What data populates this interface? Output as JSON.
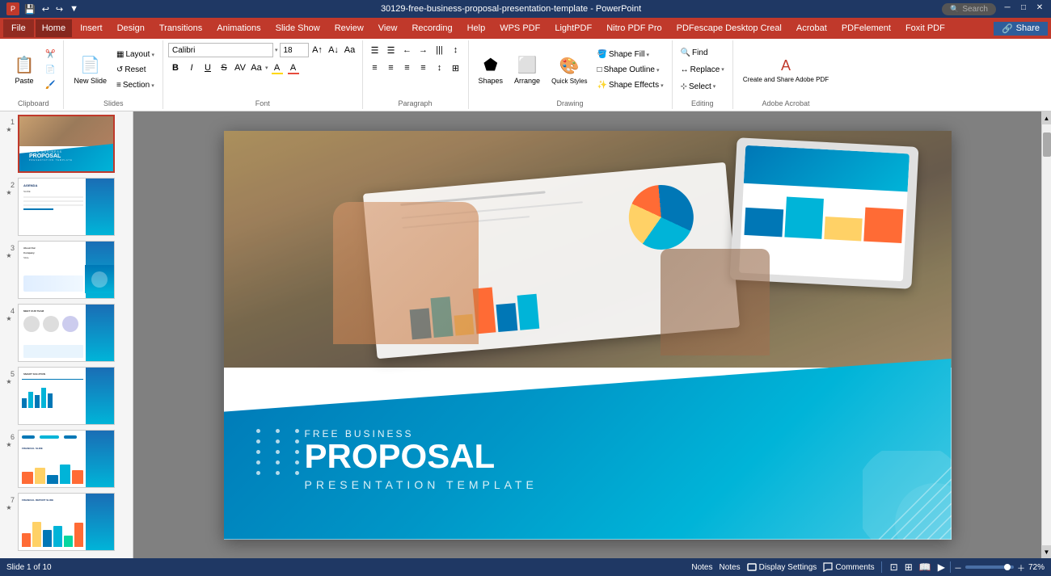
{
  "titlebar": {
    "app_icon": "📊",
    "title": "30129-free-business-proposal-presentation-template - PowerPoint",
    "search_placeholder": "Search",
    "quick_save": "💾",
    "undo": "↩",
    "redo": "↪",
    "customize": "▼"
  },
  "menubar": {
    "file": "File",
    "items": [
      "Home",
      "Insert",
      "Design",
      "Transitions",
      "Animations",
      "Slide Show",
      "Review",
      "View",
      "Recording",
      "Help",
      "WPS PDF",
      "LightPDF",
      "Nitro PDF Pro",
      "PDFescape Desktop Creal",
      "Acrobat",
      "PDFelement",
      "Foxit PDF"
    ]
  },
  "ribbon": {
    "clipboard_group": "Clipboard",
    "slides_group": "Slides",
    "font_group": "Font",
    "paragraph_group": "Paragraph",
    "drawing_group": "Drawing",
    "editing_group": "Editing",
    "acrobat_group": "Adobe Acrobat",
    "paste_label": "Paste",
    "new_slide_label": "New\nSlide",
    "layout_label": "Layout",
    "reset_label": "Reset",
    "section_label": "Section",
    "font_name": "Calibri",
    "font_size": "18",
    "bold": "B",
    "italic": "I",
    "underline": "U",
    "strikethrough": "S",
    "shapes_label": "Shapes",
    "arrange_label": "Arrange",
    "quick_styles_label": "Quick\nStyles",
    "shape_fill": "Shape Fill",
    "shape_outline": "Shape Outline",
    "shape_effects": "Shape Effects",
    "find_label": "Find",
    "replace_label": "Replace",
    "select_label": "Select",
    "create_adobe_label": "Create and Share\nAdobe PDF",
    "share_label": "Share"
  },
  "slides": [
    {
      "num": "1",
      "star": "★",
      "active": true
    },
    {
      "num": "2",
      "star": "★",
      "active": false
    },
    {
      "num": "3",
      "star": "★",
      "active": false
    },
    {
      "num": "4",
      "star": "★",
      "active": false
    },
    {
      "num": "5",
      "star": "★",
      "active": false
    },
    {
      "num": "6",
      "star": "★",
      "active": false
    },
    {
      "num": "7",
      "star": "★",
      "active": false
    }
  ],
  "slide1": {
    "subtitle": "FREE BUSINESS",
    "title": "PROPOSAL",
    "tagline": "PRESENTATION TEMPLATE"
  },
  "statusbar": {
    "slide_info": "Slide 1 of 10",
    "notes": "Notes",
    "display_settings": "Display Settings",
    "comments": "Comments",
    "zoom": "72%"
  }
}
